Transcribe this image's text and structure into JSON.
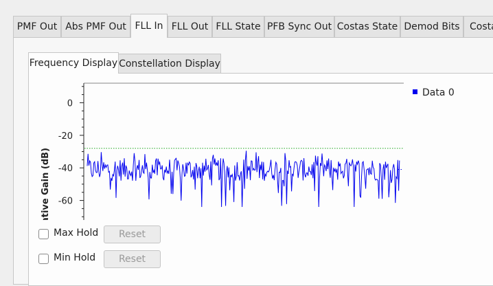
{
  "tabs": [
    {
      "label": "PMF Out"
    },
    {
      "label": "Abs PMF Out"
    },
    {
      "label": "FLL In"
    },
    {
      "label": "FLL Out"
    },
    {
      "label": "FLL State"
    },
    {
      "label": "PFB Sync Out"
    },
    {
      "label": "Costas State"
    },
    {
      "label": "Demod Bits"
    },
    {
      "label": "Costa"
    }
  ],
  "active_tab": "FLL In",
  "inner_tabs": [
    {
      "label": "Frequency Display"
    },
    {
      "label": "Constellation Display"
    }
  ],
  "controls": {
    "max_hold_label": "Max Hold",
    "min_hold_label": "Min Hold",
    "reset_label": "Reset"
  },
  "chart_data": {
    "type": "line",
    "ylabel": "ative Gain (dB)",
    "yticks": [
      0,
      -20,
      -40,
      -60
    ],
    "ylim": [
      -72,
      12
    ],
    "xlim": [
      0,
      1
    ],
    "grid": false,
    "legend_placement": "top-right",
    "series": [
      {
        "name": "Data 0",
        "color": "#0000ee",
        "noise_floor_db": -41,
        "peak_db": -28,
        "trough_db": -64
      }
    ],
    "max_hold_marker_db": -28,
    "marker_color": "#22aa22"
  }
}
